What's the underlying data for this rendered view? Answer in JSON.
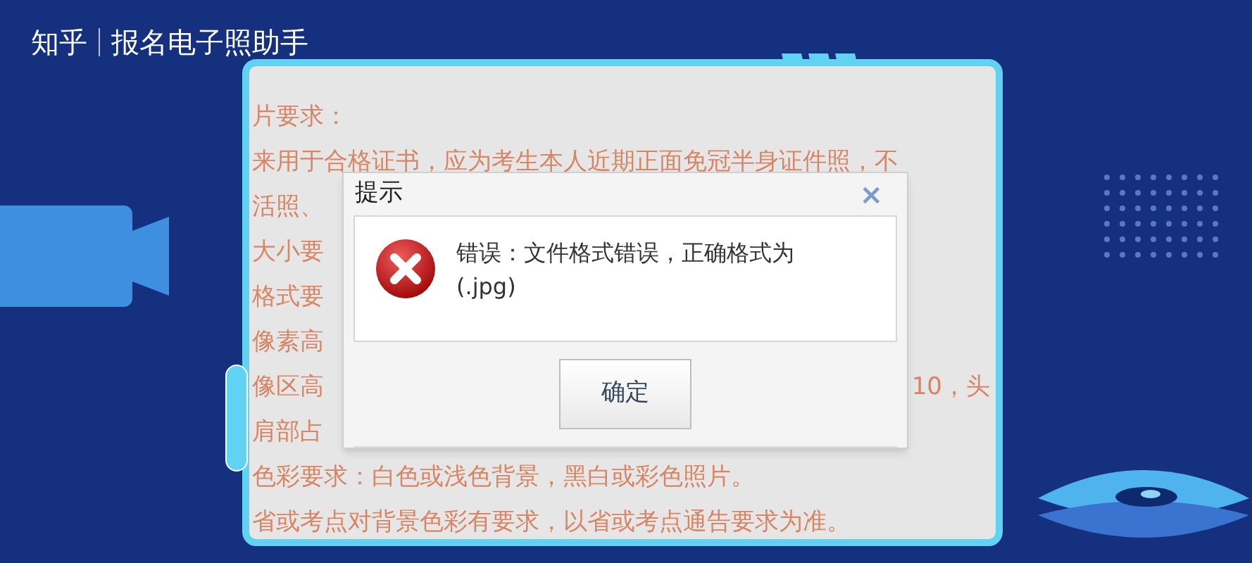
{
  "header": {
    "brand": "知乎",
    "title": "报名电子照助手"
  },
  "requirements": [
    {
      "left": "片要求："
    },
    {
      "left": "来用于合格证书，应为考生本人近期正面免冠半身证件照，不"
    },
    {
      "left": "活照、"
    },
    {
      "left": "大小要"
    },
    {
      "left": "格式要"
    },
    {
      "left": "像素高"
    },
    {
      "left": "像区高",
      "right": "10，头"
    },
    {
      "left": "肩部占"
    },
    {
      "left": "色彩要求：白色或浅色背景，黑白或彩色照片。"
    },
    {
      "left": "省或考点对背景色彩有要求，以省或考点通告要求为准。"
    }
  ],
  "dialog": {
    "title": "提示",
    "close": "×",
    "message": "错误：文件格式错误，正确格式为(.jpg)",
    "button": "确定"
  }
}
